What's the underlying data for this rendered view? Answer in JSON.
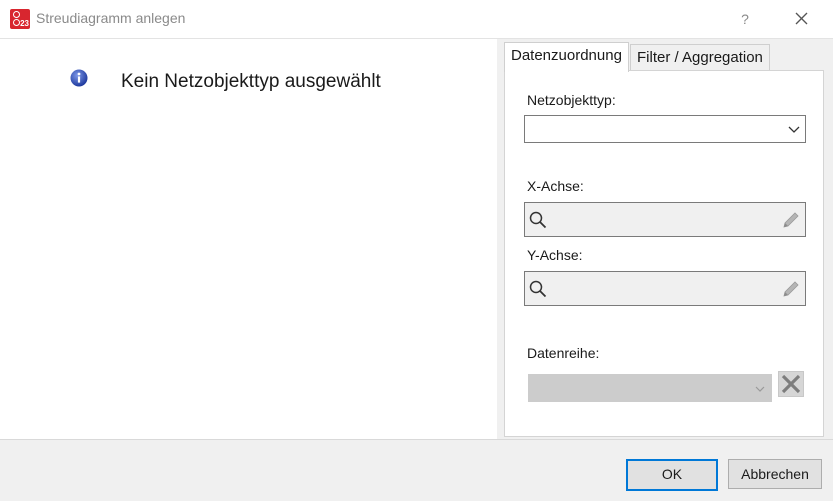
{
  "window": {
    "title": "Streudiagramm anlegen",
    "help_label": "?"
  },
  "left": {
    "info_text": "Kein Netzobjekttyp ausgewählt"
  },
  "tabs": [
    {
      "label": "Datenzuordnung",
      "active": true
    },
    {
      "label": "Filter / Aggregation",
      "active": false
    }
  ],
  "form": {
    "netzobjekttyp_label": "Netzobjekttyp:",
    "netzobjekttyp_value": "",
    "x_achse_label": "X-Achse:",
    "x_achse_value": "",
    "y_achse_label": "Y-Achse:",
    "y_achse_value": "",
    "datenreihe_label": "Datenreihe:",
    "datenreihe_value": ""
  },
  "buttons": {
    "ok": "OK",
    "cancel": "Abbrechen"
  },
  "colors": {
    "accent": "#0078d7",
    "app_icon": "#d8262f",
    "info_icon": "#2f4fb5"
  }
}
